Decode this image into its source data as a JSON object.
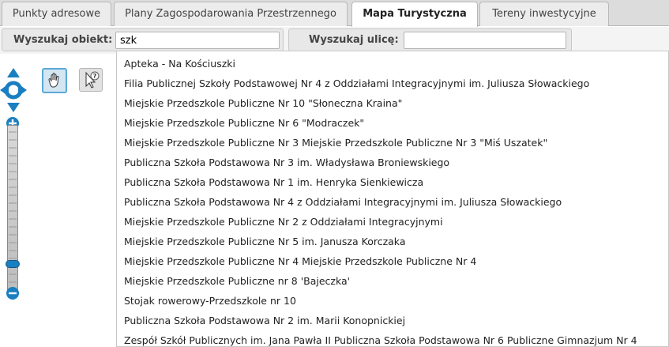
{
  "tabs": [
    {
      "label": "Punkty adresowe",
      "active": false
    },
    {
      "label": "Plany Zagospodarowania Przestrzennego",
      "active": false
    },
    {
      "label": "Mapa Turystyczna",
      "active": true
    },
    {
      "label": "Tereny inwestycyjne",
      "active": false
    }
  ],
  "search": {
    "object_label": "Wyszukaj obiekt:",
    "object_value": "szk",
    "street_label": "Wyszukaj ulicę:",
    "street_value": ""
  },
  "suggestions": [
    "Apteka - Na Kościuszki",
    "Filia Publicznej Szkoły Podstawowej Nr 4 z Oddziałami Integracyjnymi im. Juliusza Słowackiego",
    "Miejskie Przedszkole Publiczne Nr 10 \"Słoneczna Kraina\"",
    "Miejskie Przedszkole Publiczne Nr 6 \"Modraczek\"",
    "Miejskie Przedszkole Publiczne Nr 3 Miejskie Przedszkole Publiczne Nr 3 \"Miś Uszatek\"",
    "Publiczna Szkoła Podstawowa Nr 3 im. Władysława Broniewskiego",
    "Publiczna Szkoła Podstawowa Nr 1 im. Henryka Sienkiewicza",
    "Publiczna Szkoła Podstawowa Nr 4 z Oddziałami Integracyjnymi im. Juliusza Słowackiego",
    "Miejskie Przedszkole Publiczne Nr 2 z Oddziałami Integracyjnymi",
    "Miejskie Przedszkole Publiczne Nr 5 im. Janusza Korczaka",
    "Miejskie Przedszkole Publiczne Nr 4 Miejskie Przedszkole Publiczne Nr 4",
    "Miejskie Przedszkole Publiczne nr 8 'Bajeczka'",
    "Stojak rowerowy-Przedszkole nr 10",
    "Publiczna Szkoła Podstawowa Nr 2 im. Marii Konopnickiej",
    "Zespół Szkół Publicznych im. Jana Pawła II Publiczna Szkoła Podstawowa Nr 6 Publiczne Gimnazjum Nr 4"
  ],
  "map_controls": {
    "pan_icon": "pan-arrows-icon",
    "zoom_in_icon": "zoom-in-icon",
    "zoom_out_icon": "zoom-out-icon",
    "hand_tool_icon": "hand-pan-icon",
    "info_tool_icon": "info-query-icon",
    "zoom_level_fraction": 0.1
  },
  "colors": {
    "accent_blue": "#1a7fc1",
    "active_tool_border": "#5ba9d6"
  }
}
